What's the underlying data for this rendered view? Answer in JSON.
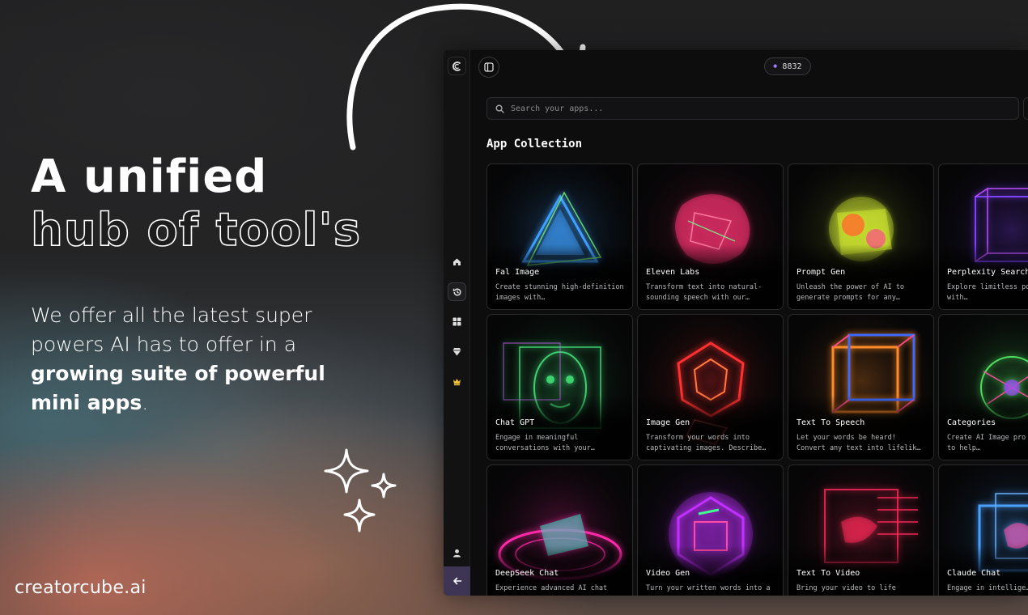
{
  "promo": {
    "headline_line1": "A unified",
    "headline_line2": "hub of tool's",
    "body_part1": "We offer all the latest super powers AI has to offer in a ",
    "body_bold": "growing suite of powerful mini apps",
    "body_end": ".",
    "brand": "creatorcube.ai"
  },
  "app": {
    "credits": "8832",
    "search_placeholder": "Search your apps...",
    "section_title": "App Collection",
    "sidebar_icons": [
      "logo-icon",
      "home-icon",
      "history-icon",
      "grid-icon",
      "gem-icon",
      "crown-icon",
      "user-icon",
      "arrow-left-icon"
    ],
    "cards": [
      {
        "name": "Fal Image",
        "desc": "Create stunning high-definition images with…",
        "color": "#3fa0ff"
      },
      {
        "name": "Eleven Labs",
        "desc": "Transform text into natural-sounding speech with our…",
        "color": "#e8306a"
      },
      {
        "name": "Prompt Gen",
        "desc": "Unleash the power of AI to generate prompts for any…",
        "color": "#c8e030"
      },
      {
        "name": "Perplexity Search",
        "desc": "Explore limitless possibilities with…",
        "color": "#8040ff"
      },
      {
        "name": "Chat GPT",
        "desc": "Engage in meaningful conversations with your…",
        "color": "#3fd070"
      },
      {
        "name": "Image Gen",
        "desc": "Transform your words into captivating images. Describe…",
        "color": "#ff3030"
      },
      {
        "name": "Text To Speech",
        "desc": "Let your words be heard! Convert any text into lifelik…",
        "color": "#ff8a2a"
      },
      {
        "name": "Categories",
        "desc": "Create AI Image pro categories to help…",
        "color": "#50e060"
      },
      {
        "name": "DeepSeek Chat",
        "desc": "Experience advanced AI chat",
        "color": "#ff2aa8"
      },
      {
        "name": "Video Gen",
        "desc": "Turn your written words into a",
        "color": "#c030ff"
      },
      {
        "name": "Text To Video",
        "desc": "Bring your video to life",
        "color": "#ff2a5a"
      },
      {
        "name": "Claude Chat",
        "desc": "Engage in intellige…",
        "color": "#4aa0ff"
      }
    ]
  }
}
